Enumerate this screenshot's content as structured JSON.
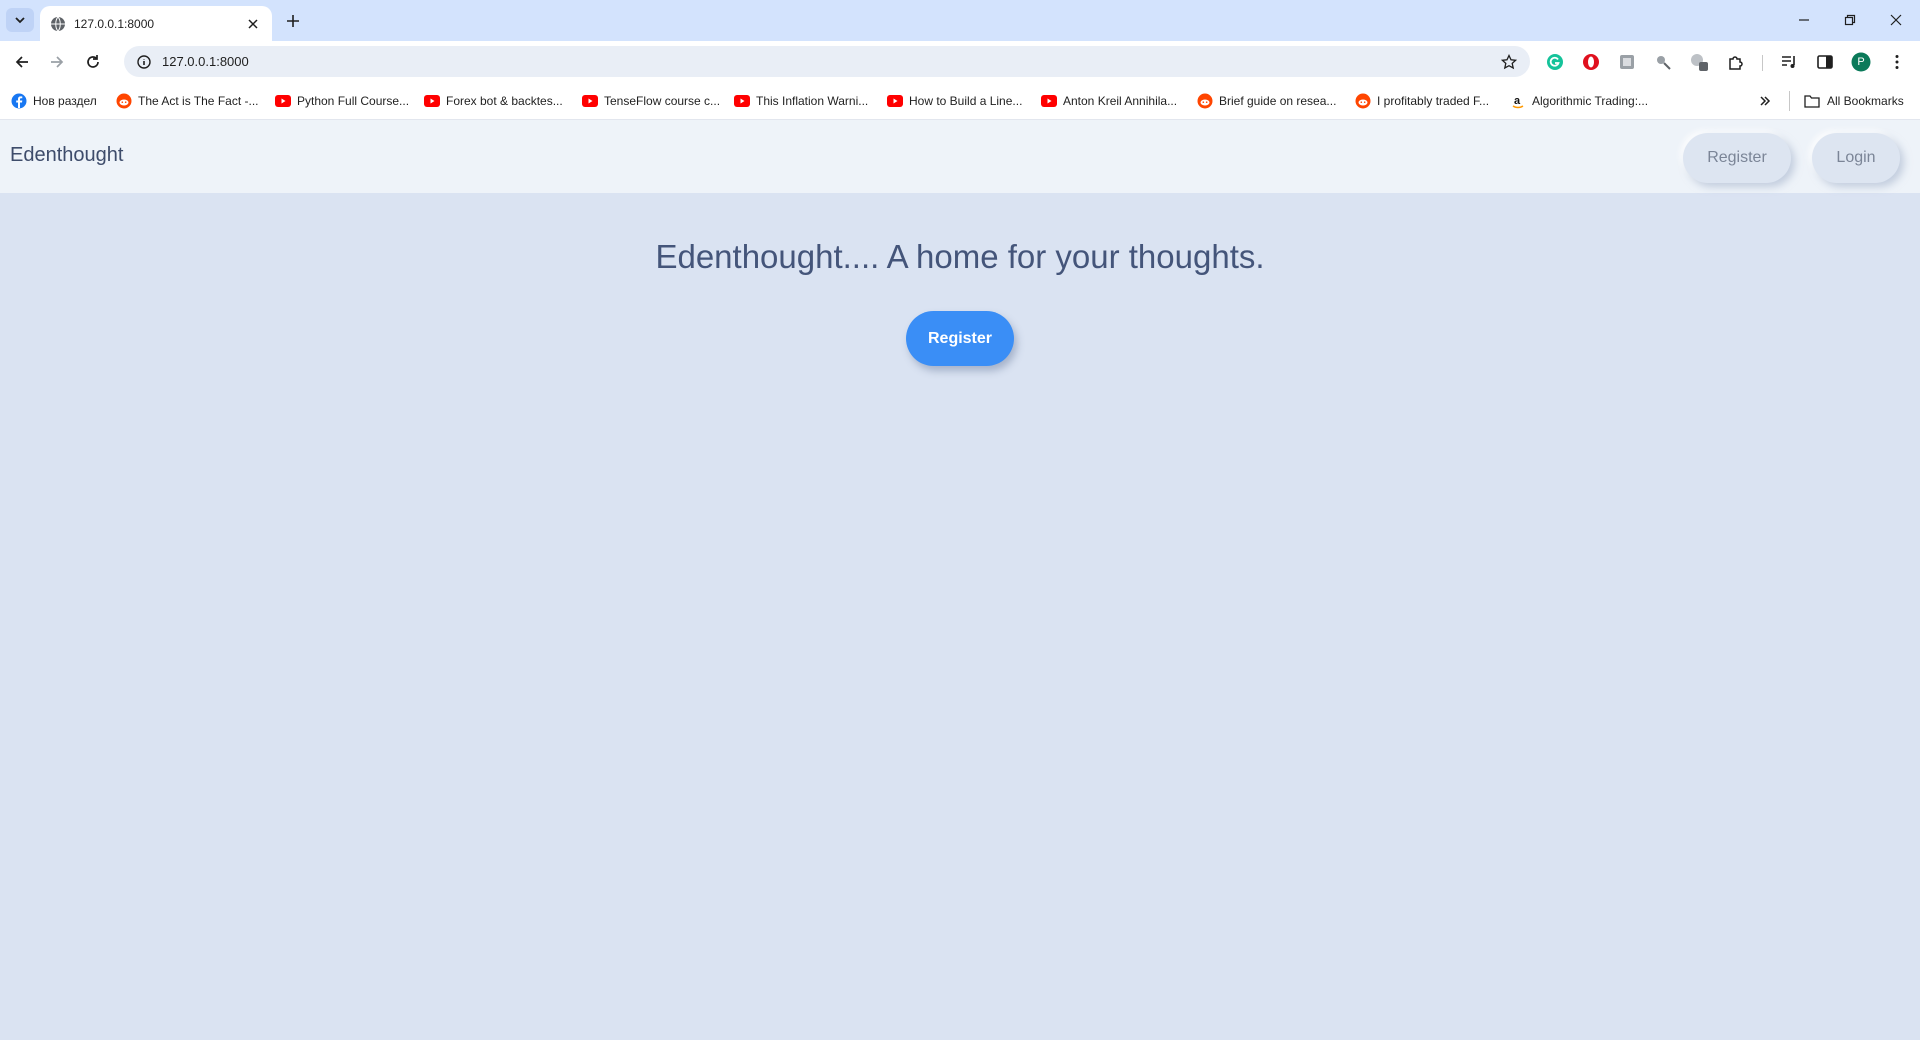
{
  "browser": {
    "tab_title": "127.0.0.1:8000",
    "url": "127.0.0.1:8000",
    "profile_initial": "P",
    "bookmarks": [
      {
        "label": "Нов раздел",
        "icon": "facebook-icon"
      },
      {
        "label": "The Act is The Fact -...",
        "icon": "reddit-icon"
      },
      {
        "label": "Python Full Course...",
        "icon": "youtube-icon"
      },
      {
        "label": "Forex bot & backtes...",
        "icon": "youtube-icon"
      },
      {
        "label": "TenseFlow course c...",
        "icon": "youtube-icon"
      },
      {
        "label": "This Inflation Warni...",
        "icon": "youtube-icon"
      },
      {
        "label": "How to Build a Line...",
        "icon": "youtube-icon"
      },
      {
        "label": "Anton Kreil Annihila...",
        "icon": "youtube-icon"
      },
      {
        "label": "Brief guide on resea...",
        "icon": "reddit-icon"
      },
      {
        "label": "I profitably traded F...",
        "icon": "reddit-icon"
      },
      {
        "label": "Algorithmic Trading:...",
        "icon": "amazon-icon"
      }
    ],
    "all_bookmarks_label": "All Bookmarks"
  },
  "site": {
    "brand": "Edenthought",
    "nav_register": "Register",
    "nav_login": "Login",
    "hero_title": "Edenthought.... A home for your thoughts.",
    "hero_button": "Register"
  },
  "colors": {
    "page_bg": "#dae3f2",
    "navbar_bg": "#eef3f9",
    "accent": "#3a8ef6",
    "text": "#44557a"
  }
}
